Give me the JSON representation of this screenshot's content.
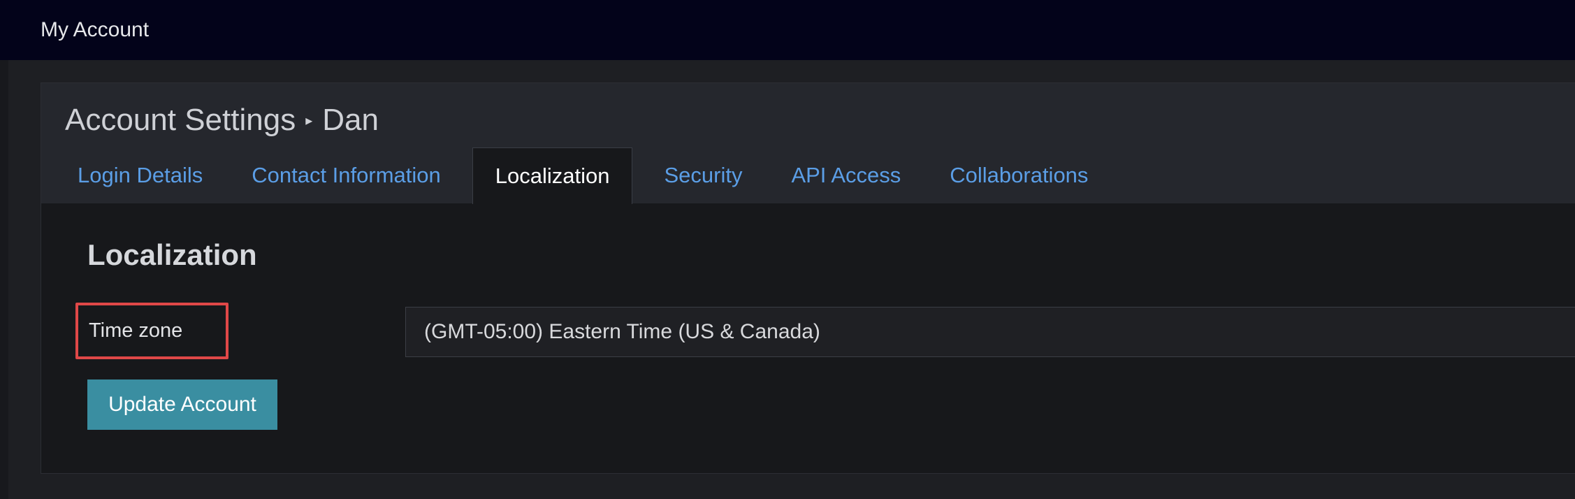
{
  "header": {
    "title": "My Account"
  },
  "page": {
    "title": "Account Settings",
    "separator": "▸",
    "user": "Dan"
  },
  "tabs": [
    {
      "label": "Login Details",
      "active": false
    },
    {
      "label": "Contact Information",
      "active": false
    },
    {
      "label": "Localization",
      "active": true
    },
    {
      "label": "Security",
      "active": false
    },
    {
      "label": "API Access",
      "active": false
    },
    {
      "label": "Collaborations",
      "active": false
    }
  ],
  "section": {
    "title": "Localization"
  },
  "form": {
    "timezone_label": "Time zone",
    "timezone_value": "(GMT-05:00) Eastern Time (US & Canada)",
    "submit_label": "Update Account"
  },
  "colors": {
    "topbar_bg": "#03031a",
    "tab_link": "#5b9ee6",
    "button_bg": "#3a8ea1",
    "highlight_border": "#e04848"
  }
}
